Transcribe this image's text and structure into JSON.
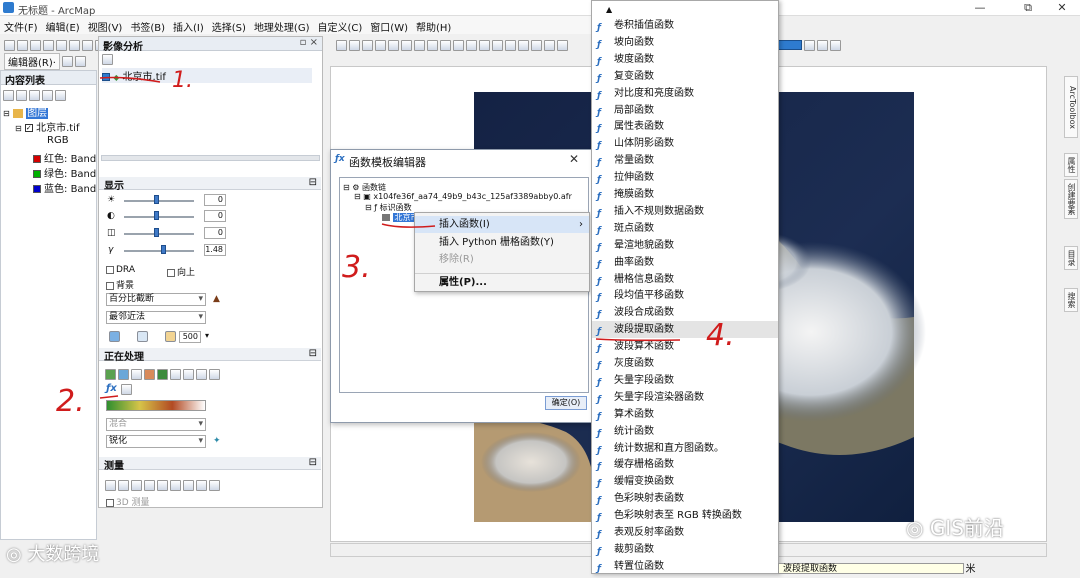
{
  "app": {
    "title": "无标题 - ArcMap",
    "window_controls": [
      "—",
      "⧉",
      "✕"
    ]
  },
  "menubar": [
    "文件(F)",
    "编辑(E)",
    "视图(V)",
    "书签(B)",
    "插入(I)",
    "选择(S)",
    "地理处理(G)",
    "自定义(C)",
    "窗口(W)",
    "帮助(H)"
  ],
  "editor_toolbar": {
    "label": "编辑器(R)·"
  },
  "toc": {
    "title": "内容列表",
    "layers_label": "图层",
    "raster_name": "北京市.tif",
    "rgb_label": "RGB",
    "bands": [
      {
        "label": "红色:",
        "value": "Band",
        "color": "#d40000"
      },
      {
        "label": "绿色:",
        "value": "Band",
        "color": "#00b000"
      },
      {
        "label": "蓝色:",
        "value": "Band",
        "color": "#0000cc"
      }
    ]
  },
  "image_analysis": {
    "title": "影像分析",
    "layer_item": "北京市.tif",
    "display_section": "显示",
    "sliders": [
      {
        "value": "0",
        "level": 0.45
      },
      {
        "value": "0",
        "level": 0.45
      },
      {
        "value": "0",
        "level": 0.45
      },
      {
        "value": "1.48",
        "level": 0.55
      }
    ],
    "dra_label": "DRA",
    "transparency_label": "向上",
    "background_label": "背景",
    "stretch_value": "百分比截断",
    "resample_value": "最邻近法",
    "scale_value": "500",
    "processing_section": "正在处理",
    "blend_value": "混合",
    "other_value": "锐化",
    "measure_section": "测量",
    "measure_3d_label": "3D 测量"
  },
  "dialog": {
    "title": "函数模板编辑器",
    "close": "✕",
    "root_node": "函数链",
    "file_node": "x104fe36f_aa74_49b9_b43c_125af3389abby0.afr",
    "identity_node": "标识函数",
    "raster_node": "北京市.tif",
    "ok_button": "确定(O)"
  },
  "context_menu": [
    {
      "label": "插入函数(I)",
      "enabled": true,
      "submenu": true
    },
    {
      "label": "插入 Python 栅格函数(Y)",
      "enabled": true
    },
    {
      "label": "移除(R)",
      "enabled": false
    },
    {
      "label": "属性(P)...",
      "enabled": true,
      "bold": true
    }
  ],
  "function_menu": [
    "卷积插值函数",
    "坡向函数",
    "坡度函数",
    "复变函数",
    "对比度和亮度函数",
    "局部函数",
    "属性表函数",
    "山体阴影函数",
    "常量函数",
    "拉伸函数",
    "掩膜函数",
    "插入不规则数据函数",
    "斑点函数",
    "晕渲地貌函数",
    "曲率函数",
    "栅格信息函数",
    "段均值平移函数",
    "波段合成函数",
    "波段提取函数",
    "波段算术函数",
    "灰度函数",
    "矢量字段函数",
    "矢量字段渲染器函数",
    "算术函数",
    "统计函数",
    "统计数据和直方图函数。",
    "缓存栅格函数",
    "缓帽变换函数",
    "色彩映射表函数",
    "色彩映射表至 RGB 转换函数",
    "表观反射率函数",
    "裁剪函数",
    "转置位函数"
  ],
  "highlighted_function": "波段提取函数",
  "tooltip": "波段提取函数",
  "scale_text": ".447 米",
  "right_dock": [
    "ArcToolbox",
    "属性",
    "创建要素",
    "目录",
    "搜索"
  ],
  "annotations": [
    "1.",
    "2.",
    "3.",
    "4."
  ],
  "watermarks": {
    "left": "大数跨境",
    "right": "GIS前沿"
  }
}
